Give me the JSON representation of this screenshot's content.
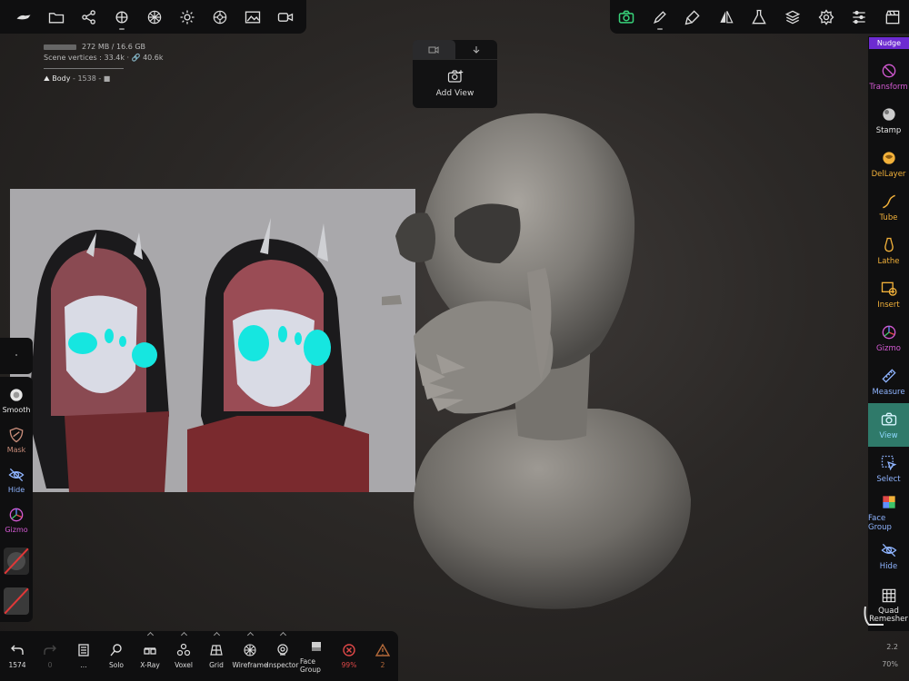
{
  "top_left_toolbar": [
    {
      "icon": "nomad-logo-icon",
      "sub": false
    },
    {
      "icon": "folder-icon",
      "sub": false
    },
    {
      "icon": "share-icon",
      "sub": false
    },
    {
      "icon": "scene-icon",
      "sub": true
    },
    {
      "icon": "mesh-sphere-icon",
      "sub": false
    },
    {
      "icon": "light-icon",
      "sub": false
    },
    {
      "icon": "material-icon",
      "sub": false
    },
    {
      "icon": "image-icon",
      "sub": false
    },
    {
      "icon": "video-icon",
      "sub": false
    }
  ],
  "top_right_toolbar": [
    {
      "icon": "camera-icon",
      "active": true
    },
    {
      "icon": "pen-icon",
      "sub": true
    },
    {
      "icon": "brush-icon",
      "sub": false
    },
    {
      "icon": "symmetry-icon",
      "sub": false
    },
    {
      "icon": "flask-icon",
      "sub": false
    },
    {
      "icon": "layers-icon",
      "sub": false
    },
    {
      "icon": "settings-icon",
      "sub": false
    },
    {
      "icon": "sliders-icon",
      "sub": false
    },
    {
      "icon": "clapper-icon",
      "sub": false
    }
  ],
  "stats": {
    "memory": "272 MB / 16.6 GB",
    "vertices": "Scene vertices : 33.4k · 🔗 40.6k",
    "object_name": "Body",
    "object_info": " - 1538 - "
  },
  "add_view": {
    "label": "Add View"
  },
  "right_tools": {
    "nudge": "Nudge",
    "items": [
      {
        "label": "Transform",
        "color": "#d45ad4"
      },
      {
        "label": "Stamp",
        "color": "#e6e6e6"
      },
      {
        "label": "DelLayer",
        "color": "#f2b13a"
      },
      {
        "label": "Tube",
        "color": "#f2b13a"
      },
      {
        "label": "Lathe",
        "color": "#f2b13a"
      },
      {
        "label": "Insert",
        "color": "#f2b13a"
      },
      {
        "label": "Gizmo",
        "color": "#d45ad4"
      },
      {
        "label": "Measure",
        "color": "#8fb4ff"
      },
      {
        "label": "View",
        "color": "#8fd8ff"
      },
      {
        "label": "Select",
        "color": "#8fb4ff"
      },
      {
        "label": "Face Group",
        "color": "#8fb4ff"
      },
      {
        "label": "Hide",
        "color": "#8fb4ff"
      },
      {
        "label": "Quad Remesher",
        "color": "#e6e6e6"
      }
    ]
  },
  "left_tools": [
    {
      "label": "Smooth",
      "color": "#e6e6e6"
    },
    {
      "label": "Mask",
      "color": "#c98d7a"
    },
    {
      "label": "Hide",
      "color": "#8fb4ff"
    },
    {
      "label": "Gizmo",
      "color": "#d45ad4"
    }
  ],
  "bottom_tools": [
    {
      "label": "1574",
      "icon": "undo-icon"
    },
    {
      "label": "0",
      "icon": "redo-icon"
    },
    {
      "label": "...",
      "icon": "panel-icon"
    },
    {
      "label": "Solo",
      "icon": "magnify-icon"
    },
    {
      "label": "X-Ray",
      "icon": "glasses-icon"
    },
    {
      "label": "Voxel",
      "icon": "voxel-icon"
    },
    {
      "label": "Grid",
      "icon": "grid-icon"
    },
    {
      "label": "Wireframe",
      "icon": "wireframe-icon"
    },
    {
      "label": "Inspector",
      "icon": "inspector-icon"
    },
    {
      "label": "Face Group",
      "icon": "facegroup-icon"
    },
    {
      "label": "99%",
      "icon": "error-icon"
    },
    {
      "label": "2",
      "icon": "warning-icon"
    }
  ],
  "corner": {
    "version": "2.2",
    "zoom": "70%"
  }
}
